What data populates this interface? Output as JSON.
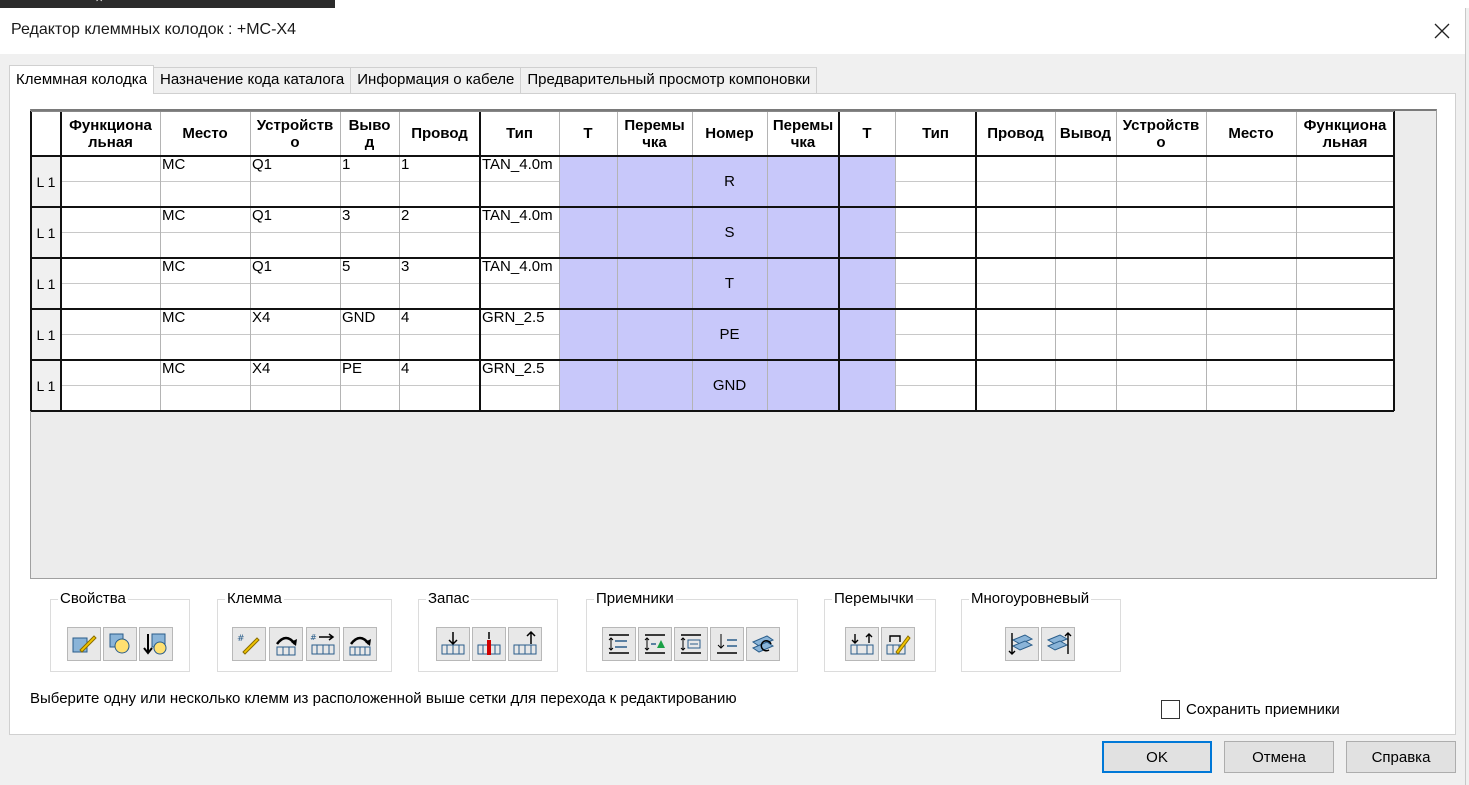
{
  "title": "Редактор клеммных колодок : +MC-X4",
  "tabs": [
    "Клеммная колодка",
    "Назначение кода каталога",
    "Информация о кабеле",
    "Предварительный просмотр компоновки"
  ],
  "grid": {
    "headers": [
      "Функциональная",
      "Место",
      "Устройство",
      "Вывод",
      "Провод",
      "Тип",
      "Т",
      "Перемычка",
      "Номер",
      "Перемычка",
      "Т",
      "Тип",
      "Провод",
      "Вывод",
      "Устройство",
      "Место",
      "Функциональная"
    ],
    "header_display": [
      "Функциона\nльная",
      "Место",
      "Устройств\nо",
      "Выво\nд",
      "Провод",
      "Тип",
      "Т",
      "Перемы\nчка",
      "Номер",
      "Перемы\nчка",
      "Т",
      "Тип",
      "Провод",
      "Вывод",
      "Устройств\nо",
      "Место",
      "Функциона\nльная"
    ],
    "rows": [
      {
        "level": "L 1",
        "place": "MC",
        "device": "Q1",
        "pin": "1",
        "wire": "1",
        "type": "TAN_4.0m",
        "number": "R"
      },
      {
        "level": "L 1",
        "place": "MC",
        "device": "Q1",
        "pin": "3",
        "wire": "2",
        "type": "TAN_4.0m",
        "number": "S"
      },
      {
        "level": "L 1",
        "place": "MC",
        "device": "Q1",
        "pin": "5",
        "wire": "3",
        "type": "TAN_4.0m",
        "number": "T"
      },
      {
        "level": "L 1",
        "place": "MC",
        "device": "X4",
        "pin": "GND",
        "wire": "4",
        "type": "GRN_2.5",
        "number": "PE"
      },
      {
        "level": "L 1",
        "place": "MC",
        "device": "X4",
        "pin": "PE",
        "wire": "4",
        "type": "GRN_2.5",
        "number": "GND"
      }
    ]
  },
  "groups": {
    "properties": {
      "label": "Свойства",
      "icons": [
        "edit-properties-icon",
        "copy-properties-icon",
        "paste-properties-icon"
      ]
    },
    "terminal": {
      "label": "Клемма",
      "icons": [
        "renumber-terminal-icon",
        "flip-terminal-icon",
        "move-terminal-icon",
        "rotate-terminal-icon"
      ]
    },
    "spare": {
      "label": "Запас",
      "icons": [
        "insert-spare-icon",
        "spare-marker-icon",
        "remove-spare-icon"
      ]
    },
    "receivers": {
      "label": "Приемники",
      "icons": [
        "receiver-up-icon",
        "receiver-insert-icon",
        "receiver-list-icon",
        "receiver-down-icon",
        "receiver-refresh-icon"
      ]
    },
    "jumpers": {
      "label": "Перемычки",
      "icons": [
        "jumper-add-icon",
        "jumper-edit-icon"
      ]
    },
    "multilevel": {
      "label": "Многоуровневый",
      "icons": [
        "multilevel-down-icon",
        "multilevel-up-icon"
      ]
    }
  },
  "hint": "Выберите одну или несколько клемм из расположенной выше сетки для перехода к редактированию",
  "save_receivers": {
    "label": "Сохранить приемники",
    "checked": false
  },
  "buttons": {
    "ok": "OK",
    "cancel": "Отмена",
    "help": "Справка"
  },
  "colors": {
    "jumper_area": "#c8c8fa",
    "default_button_border": "#0078d7"
  }
}
